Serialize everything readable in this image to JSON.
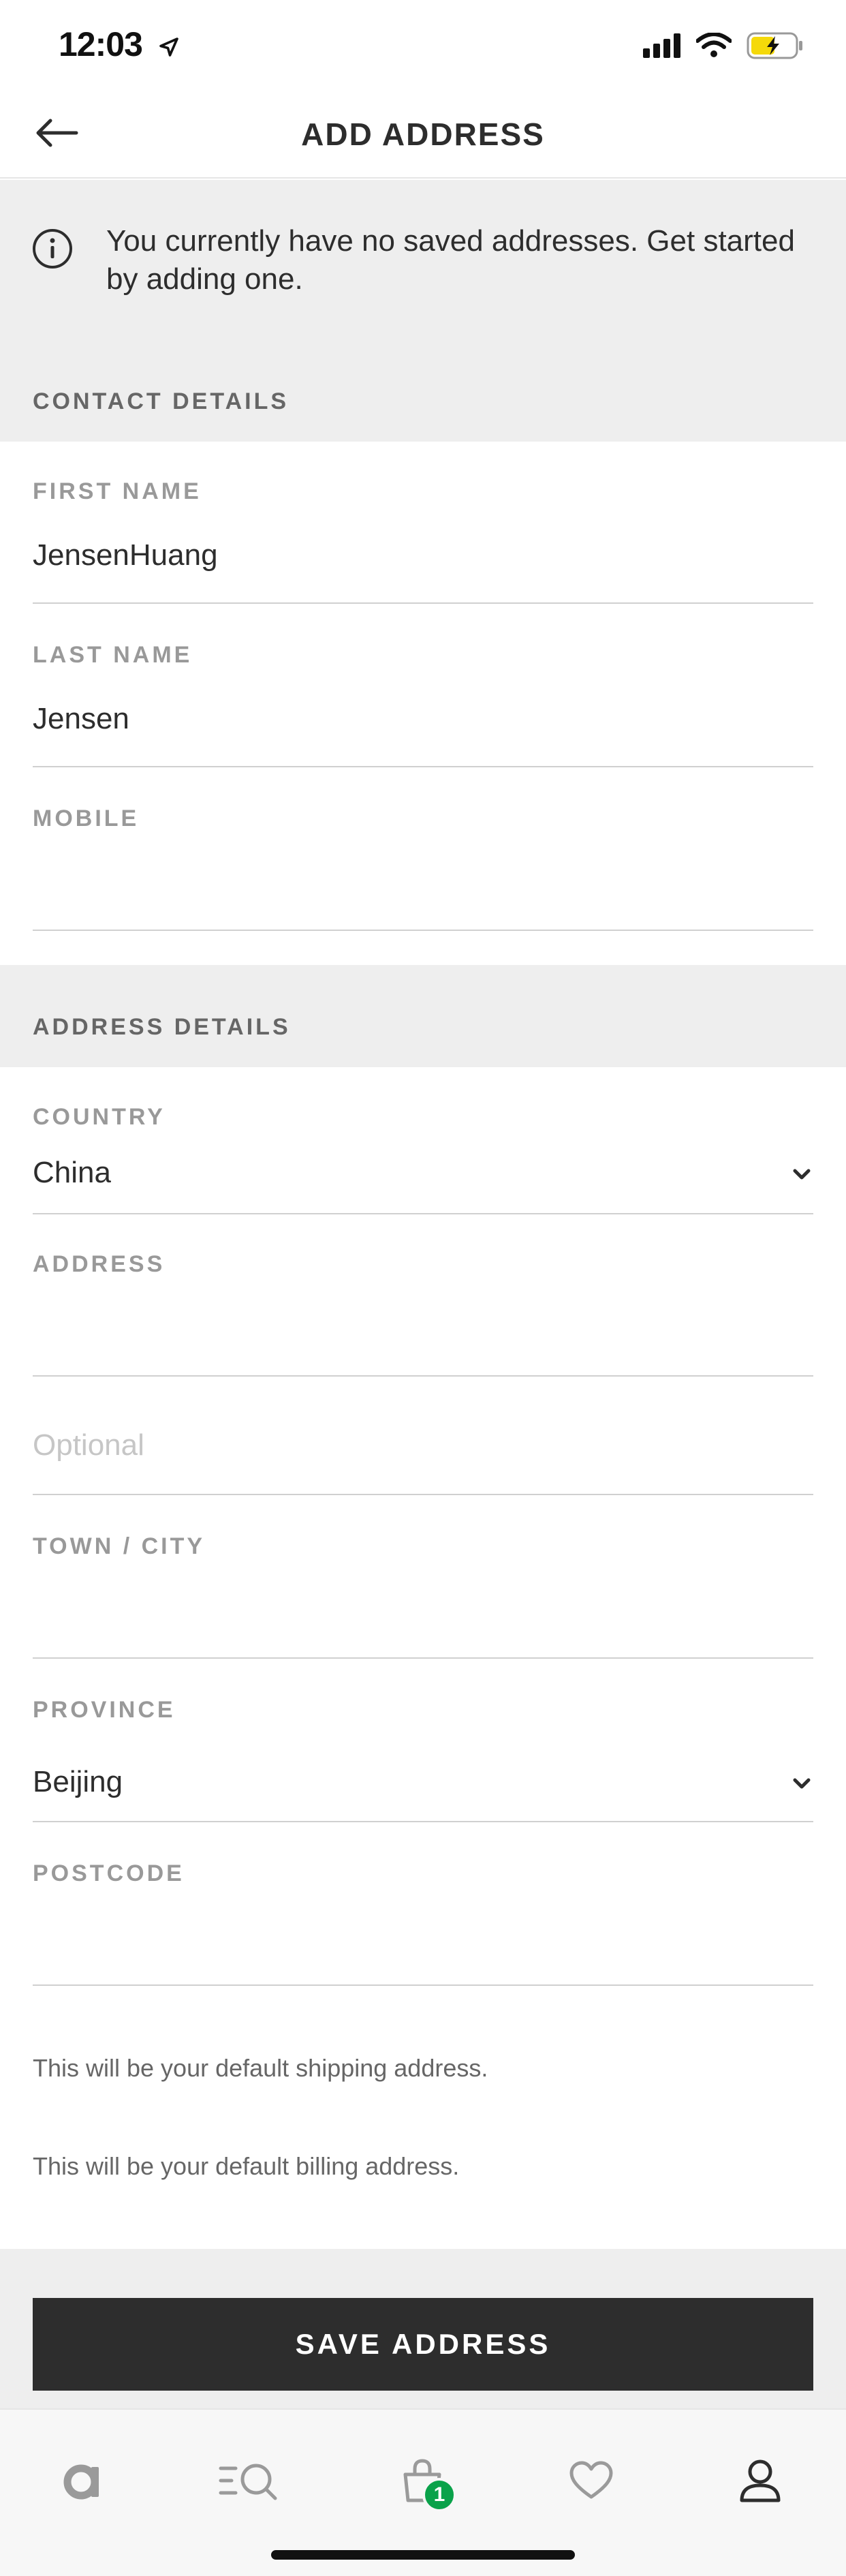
{
  "status_bar": {
    "time": "12:03"
  },
  "header": {
    "title": "ADD ADDRESS"
  },
  "info_banner": {
    "text": "You currently have no saved addresses. Get started by adding one."
  },
  "contact": {
    "heading": "CONTACT DETAILS",
    "first_name": {
      "label": "FIRST NAME",
      "value": "JensenHuang"
    },
    "last_name": {
      "label": "LAST NAME",
      "value": "Jensen"
    },
    "mobile": {
      "label": "MOBILE",
      "value": ""
    }
  },
  "address": {
    "heading": "ADDRESS DETAILS",
    "country": {
      "label": "COUNTRY",
      "value": "China"
    },
    "address_line": {
      "label": "ADDRESS",
      "value": ""
    },
    "address_optional": {
      "placeholder": "Optional"
    },
    "town": {
      "label": "TOWN / CITY",
      "value": ""
    },
    "province": {
      "label": "PROVINCE",
      "value": "Beijing"
    },
    "postcode": {
      "label": "POSTCODE",
      "value": ""
    }
  },
  "notes": {
    "shipping": "This will be your default shipping address.",
    "billing": "This will be your default billing address."
  },
  "save_button": {
    "label": "SAVE ADDRESS"
  },
  "tab_bar": {
    "items": [
      {
        "icon": "home-logo-icon"
      },
      {
        "icon": "search-categories-icon"
      },
      {
        "icon": "shopping-bag-icon",
        "badge": "1"
      },
      {
        "icon": "heart-icon"
      },
      {
        "icon": "account-icon"
      }
    ]
  },
  "colors": {
    "primary_button": "#2d2d2d",
    "section_background": "#eeeeee",
    "badge": "#0aa24a",
    "battery": "#f5d90a"
  }
}
